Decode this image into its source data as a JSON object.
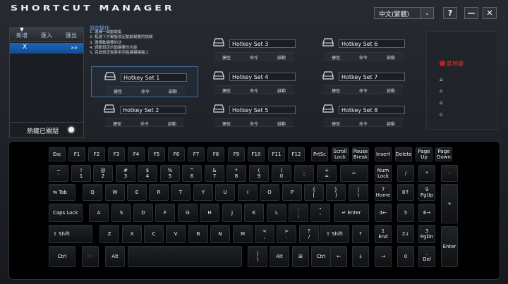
{
  "app": {
    "title": "SHORTCUT MANAGER",
    "language": "中文(繁體)",
    "help": "?",
    "minimize": "—",
    "close": "✕"
  },
  "left": {
    "arrow": "▼",
    "new": "新增",
    "import": "匯入",
    "export": "匯出",
    "profile": "X",
    "profile_arrow": "»»",
    "hotkey_status": "熱鍵已關閉"
  },
  "steps": {
    "heading": "設定操作",
    "lines": [
      "1. 選擇一個動鍵集",
      "2. 點選下方鍵盤預定動動鍵要的換鍵",
      "3. 選擇動鍵要的功",
      "4. 調節設定的動鍵要的功能",
      "5. 完成設定後套用到指鍵鍵鍵盤上"
    ]
  },
  "hotkey_sets": [
    {
      "name": "Hotkey Set 1",
      "tabs": [
        "捷徑",
        "命令",
        "啟動"
      ]
    },
    {
      "name": "Hotkey Set 2",
      "tabs": [
        "捷徑",
        "命令",
        "啟動"
      ]
    },
    {
      "name": "Hotkey Set 3",
      "tabs": [
        "捷徑",
        "命令",
        "啟動"
      ]
    },
    {
      "name": "Hotkey Set 4",
      "tabs": [
        "捷徑",
        "命令",
        "啟動"
      ]
    },
    {
      "name": "Hotkey Set 5",
      "tabs": [
        "捷徑",
        "命令",
        "啟動"
      ]
    },
    {
      "name": "Hotkey Set 6",
      "tabs": [
        "捷徑",
        "命令",
        "啟動"
      ]
    },
    {
      "name": "Hotkey Set 7",
      "tabs": [
        "捷徑",
        "命令",
        "啟動"
      ]
    },
    {
      "name": "Hotkey Set 8",
      "tabs": [
        "捷徑",
        "命令",
        "啟動"
      ]
    }
  ],
  "disabled": {
    "label": "禁用鍵"
  },
  "keyboard": {
    "keys": [
      [
        "Esc",
        ""
      ],
      [
        "F1",
        ""
      ],
      [
        "F2",
        ""
      ],
      [
        "F3",
        ""
      ],
      [
        "F4",
        ""
      ],
      [
        "F5",
        ""
      ],
      [
        "F6",
        ""
      ],
      [
        "F7",
        ""
      ],
      [
        "F8",
        ""
      ],
      [
        "F9",
        ""
      ],
      [
        "F10",
        ""
      ],
      [
        "F11",
        ""
      ],
      [
        "F12",
        ""
      ],
      [
        "PrtSc",
        ""
      ],
      [
        "Scroll",
        "Lock"
      ],
      [
        "Pause",
        "Break"
      ],
      [
        "Insert",
        ""
      ],
      [
        "Delete",
        ""
      ],
      [
        "Page",
        "Up"
      ],
      [
        "Page",
        "Down"
      ],
      [
        "~",
        "`"
      ],
      [
        "!",
        "1"
      ],
      [
        "@",
        "2"
      ],
      [
        "#",
        "3"
      ],
      [
        "$",
        "4"
      ],
      [
        "%",
        "5"
      ],
      [
        "^",
        "6"
      ],
      [
        "&",
        "7"
      ],
      [
        "*",
        "8"
      ],
      [
        "(",
        "9"
      ],
      [
        ")",
        "0"
      ],
      [
        "_",
        "-"
      ],
      [
        "+",
        "="
      ],
      [
        "←",
        ""
      ],
      [
        "Num",
        "Lock"
      ],
      [
        "/",
        ""
      ],
      [
        "*",
        ""
      ],
      [
        "-",
        ""
      ],
      [
        "⇆ Tab",
        ""
      ],
      [
        "Q",
        ""
      ],
      [
        "W",
        ""
      ],
      [
        "E",
        ""
      ],
      [
        "R",
        ""
      ],
      [
        "T",
        ""
      ],
      [
        "Y",
        ""
      ],
      [
        "U",
        ""
      ],
      [
        "I",
        ""
      ],
      [
        "O",
        ""
      ],
      [
        "P",
        ""
      ],
      [
        "{",
        "["
      ],
      [
        "}",
        "]"
      ],
      [
        "|",
        "\\"
      ],
      [
        "7",
        "Home"
      ],
      [
        "8↑",
        ""
      ],
      [
        "9",
        "PgUp"
      ],
      [
        "+",
        ""
      ],
      [
        "Caps Lock",
        ""
      ],
      [
        "A",
        ""
      ],
      [
        "S",
        ""
      ],
      [
        "D",
        ""
      ],
      [
        "F",
        ""
      ],
      [
        "G",
        ""
      ],
      [
        "H",
        ""
      ],
      [
        "J",
        ""
      ],
      [
        "K",
        ""
      ],
      [
        "L",
        ""
      ],
      [
        ":",
        ";"
      ],
      [
        "\"",
        "'"
      ],
      [
        "↵ Enter",
        ""
      ],
      [
        "4←",
        ""
      ],
      [
        "5",
        ""
      ],
      [
        "6→",
        ""
      ],
      [
        "⇧ Shift",
        ""
      ],
      [
        "Z",
        ""
      ],
      [
        "X",
        ""
      ],
      [
        "C",
        ""
      ],
      [
        "V",
        ""
      ],
      [
        "B",
        ""
      ],
      [
        "N",
        ""
      ],
      [
        "M",
        ""
      ],
      [
        "<",
        ","
      ],
      [
        ">",
        "."
      ],
      [
        "?",
        "/"
      ],
      [
        "⇧ Shift",
        ""
      ],
      [
        "↑",
        ""
      ],
      [
        "1",
        "End"
      ],
      [
        "2↓",
        ""
      ],
      [
        "3",
        "PgDn"
      ],
      [
        "Enter",
        ""
      ],
      [
        "Ctrl",
        ""
      ],
      [
        "Fn",
        ""
      ],
      [
        "Alt",
        ""
      ],
      [
        "",
        ""
      ],
      [
        "|",
        "\\"
      ],
      [
        "Alt",
        ""
      ],
      [
        "⊞",
        ""
      ],
      [
        "Ctrl",
        ""
      ],
      [
        "←",
        ""
      ],
      [
        "↓",
        ""
      ],
      [
        "→",
        ""
      ],
      [
        "0",
        ""
      ],
      [
        ".",
        "Del"
      ]
    ]
  }
}
